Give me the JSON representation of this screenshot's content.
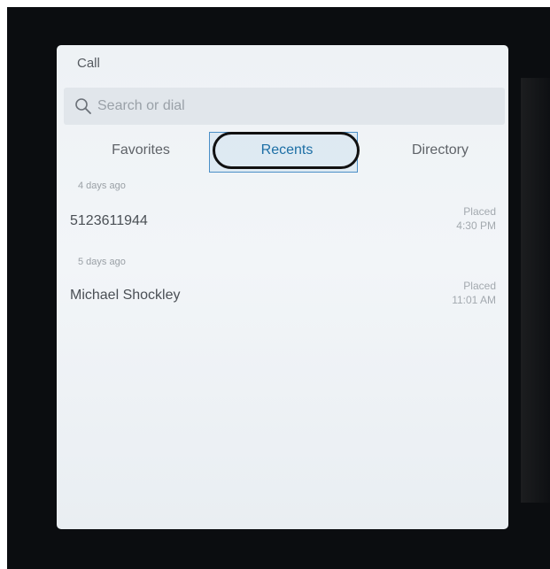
{
  "panel": {
    "title": "Call"
  },
  "search": {
    "placeholder": "Search or dial",
    "value": ""
  },
  "tabs": [
    {
      "label": "Favorites",
      "selected": false
    },
    {
      "label": "Recents",
      "selected": true
    },
    {
      "label": "Directory",
      "selected": false
    }
  ],
  "recents": [
    {
      "section_label": "4 days ago",
      "name": "5123611944",
      "status": "Placed",
      "time": "4:30 PM"
    },
    {
      "section_label": "5 days ago",
      "name": "Michael Shockley",
      "status": "Placed",
      "time": "11:01 AM"
    }
  ],
  "colors": {
    "accent": "#1d6fa5",
    "panel_background": "#eef2f5",
    "screen_background": "#0b0d10"
  }
}
